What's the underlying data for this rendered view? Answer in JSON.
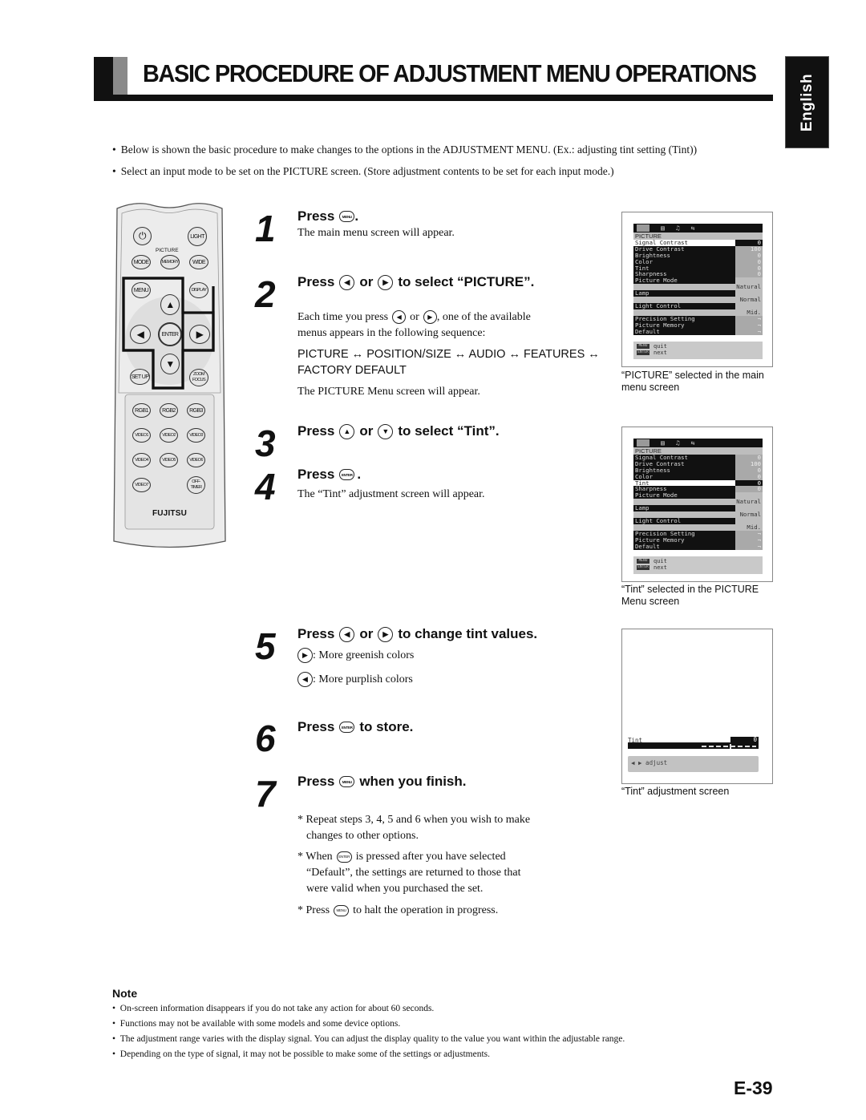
{
  "header": {
    "title": "BASIC PROCEDURE OF ADJUSTMENT MENU OPERATIONS",
    "language_tab": "English"
  },
  "intro": [
    "Below is shown the basic procedure to make changes to the options in the ADJUSTMENT MENU. (Ex.: adjusting tint setting (Tint))",
    "Select an input mode to be set on the PICTURE screen. (Store adjustment contents to be set for each input mode.)"
  ],
  "bullet": "•",
  "remote": {
    "brand": "FUJITSU",
    "picture_group_label": "PICTURE",
    "buttons": {
      "power": "⏻",
      "light": "LIGHT",
      "mode": "MODE",
      "memory": "MEMORY",
      "wide": "WIDE",
      "menu": "MENU",
      "display": "DISPLAY",
      "up": "▲",
      "left": "◀",
      "enter": "ENTER",
      "right": "▶",
      "down": "▼",
      "setup": "SET UP",
      "zoom_focus": "ZOOM FOCUS",
      "rgb1": "RGB1",
      "rgb2": "RGB2",
      "rgb3": "RGB3",
      "video1": "VIDEO1",
      "video2": "VIDEO2",
      "video3": "VIDEO3",
      "video4": "VIDEO4",
      "video5": "VIDEO5",
      "video6": "VIDEO6",
      "video7": "VIDEO7",
      "off_timer": "OFF-TIMER"
    }
  },
  "icons": {
    "menu": "MENU",
    "enter": "ENTER",
    "left": "◀",
    "right": "▶",
    "up": "▲",
    "down": "▼"
  },
  "steps": {
    "s1": {
      "num": "1",
      "press": "Press",
      "end": ".",
      "body": "The main menu screen will appear."
    },
    "s2": {
      "num": "2",
      "press": "Press",
      "or": "or",
      "rest": "to select “PICTURE”.",
      "body_a": "Each time you press",
      "body_or": "or",
      "body_b": ", one of the available",
      "body_line2": "menus appears in the following sequence:",
      "sequence_line1": "PICTURE ↔ POSITION/SIZE ↔ AUDIO ↔ FEATURES ↔",
      "sequence_line2": "FACTORY DEFAULT",
      "body_end": "The PICTURE Menu screen will appear."
    },
    "s3": {
      "num": "3",
      "press": "Press",
      "or": "or",
      "rest": "to select “Tint”."
    },
    "s4": {
      "num": "4",
      "press": "Press",
      "end": ".",
      "body": "The “Tint” adjustment screen will appear."
    },
    "s5": {
      "num": "5",
      "press": "Press",
      "or": "or",
      "rest": "to change tint values.",
      "right_desc": ": More greenish colors",
      "left_desc": ": More purplish colors"
    },
    "s6": {
      "num": "6",
      "press": "Press",
      "rest": "to store."
    },
    "s7": {
      "num": "7",
      "press": "Press",
      "rest": "when you finish."
    }
  },
  "footnotes": {
    "f1_line1": "* Repeat steps 3, 4, 5 and 6 when you wish to make",
    "f1_line2": "changes to other options.",
    "f2_a": "* When",
    "f2_b": "is pressed after you have selected",
    "f2_line2": "“Default”, the settings are returned to those that",
    "f2_line3": "were valid when you purchased the set.",
    "f3_a": "* Press",
    "f3_b": "to halt the operation in progress."
  },
  "osd": {
    "menu_title": "PICTURE",
    "rows": [
      {
        "label": "Signal Contrast",
        "value": "0"
      },
      {
        "label": "Drive Contrast",
        "value": "100"
      },
      {
        "label": "Brightness",
        "value": "0"
      },
      {
        "label": "Color",
        "value": "0"
      },
      {
        "label": "Tint",
        "value": "0"
      },
      {
        "label": "Sharpness",
        "value": "0"
      },
      {
        "label": "Picture Mode",
        "value": "Natural"
      },
      {
        "label": "Lamp",
        "value": "Normal"
      },
      {
        "label": "Light Control",
        "value": "Mid."
      },
      {
        "label": "Precision Setting",
        "value": "¬"
      },
      {
        "label": "Picture Memory",
        "value": "¬"
      },
      {
        "label": "Default",
        "value": "¬"
      }
    ],
    "help_quit_key": "MENU",
    "help_quit": "quit",
    "help_next_key": "ENTER",
    "help_next": "next",
    "adjust_label": "Tint",
    "adjust_value": "0",
    "adjust_help": "◀ ▶  adjust"
  },
  "screens": [
    {
      "caption_line1": "“PICTURE” selected in the main",
      "caption_line2": "menu screen",
      "selected": "Signal Contrast"
    },
    {
      "caption_line1": "“Tint” selected in the PICTURE",
      "caption_line2": "Menu screen",
      "selected": "Tint"
    },
    {
      "caption_line1": "“Tint” adjustment screen"
    }
  ],
  "note": {
    "title": "Note",
    "items": [
      "On-screen information disappears if you do not take any action for about 60 seconds.",
      "Functions may not be available with some models and some device options.",
      "The adjustment range varies with the display signal. You can adjust the display quality to the value you want within the adjustable range.",
      "Depending on the type of signal, it may not be possible to make some of the settings or adjustments."
    ]
  },
  "page_number": "E-39"
}
